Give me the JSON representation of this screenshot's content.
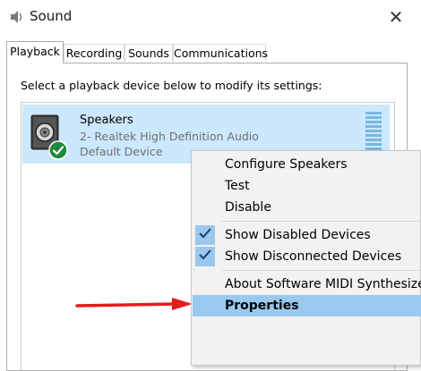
{
  "window": {
    "title": "Sound"
  },
  "tabs": [
    {
      "label": "Playback"
    },
    {
      "label": "Recording"
    },
    {
      "label": "Sounds"
    },
    {
      "label": "Communications"
    }
  ],
  "instruction": "Select a playback device below to modify its settings:",
  "device": {
    "name": "Speakers",
    "driver": "2- Realtek High Definition Audio",
    "status": "Default Device"
  },
  "context_menu": {
    "items": [
      {
        "label": "Configure Speakers"
      },
      {
        "label": "Test"
      },
      {
        "label": "Disable"
      },
      {
        "label": "Show Disabled Devices",
        "checked": true
      },
      {
        "label": "Show Disconnected Devices",
        "checked": true
      },
      {
        "label": "About Software MIDI Synthesizer"
      },
      {
        "label": "Properties",
        "highlighted": true
      }
    ]
  },
  "colors": {
    "selection": "#cce8ff",
    "menu_highlight": "#99c9ef",
    "annotation_arrow": "#e31b1b",
    "check_green": "#1e8a3c"
  },
  "icons": {
    "title": "speaker-title-icon",
    "close": "close-icon",
    "device": "speaker-device-icon",
    "badge": "default-check-icon",
    "checkmark": "checkmark-icon",
    "arrow": "red-arrow-annotation"
  }
}
